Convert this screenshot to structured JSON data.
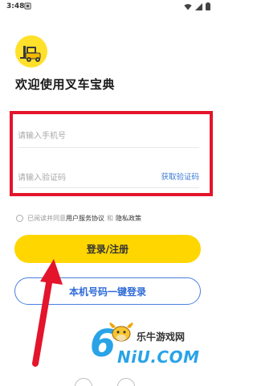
{
  "status_bar": {
    "time": "3:48"
  },
  "welcome": {
    "title": "欢迎使用叉车宝典"
  },
  "form": {
    "phone_placeholder": "请输入手机号",
    "code_placeholder": "请输入验证码",
    "get_code_label": "获取验证码"
  },
  "agreement": {
    "prefix": "已阅读并同意",
    "user_agreement": "用户服务协议",
    "and": "和",
    "privacy_policy": "隐私政策"
  },
  "buttons": {
    "login_register": "登录/注册",
    "one_click_login": "本机号码一键登录"
  },
  "watermark": {
    "digit": "6",
    "cn_text": "乐牛游戏网",
    "en_text": "NiU.COM"
  },
  "colors": {
    "accent_yellow": "#ffd600",
    "link_blue": "#3a7bd5",
    "annotation_red": "#e3142b"
  }
}
